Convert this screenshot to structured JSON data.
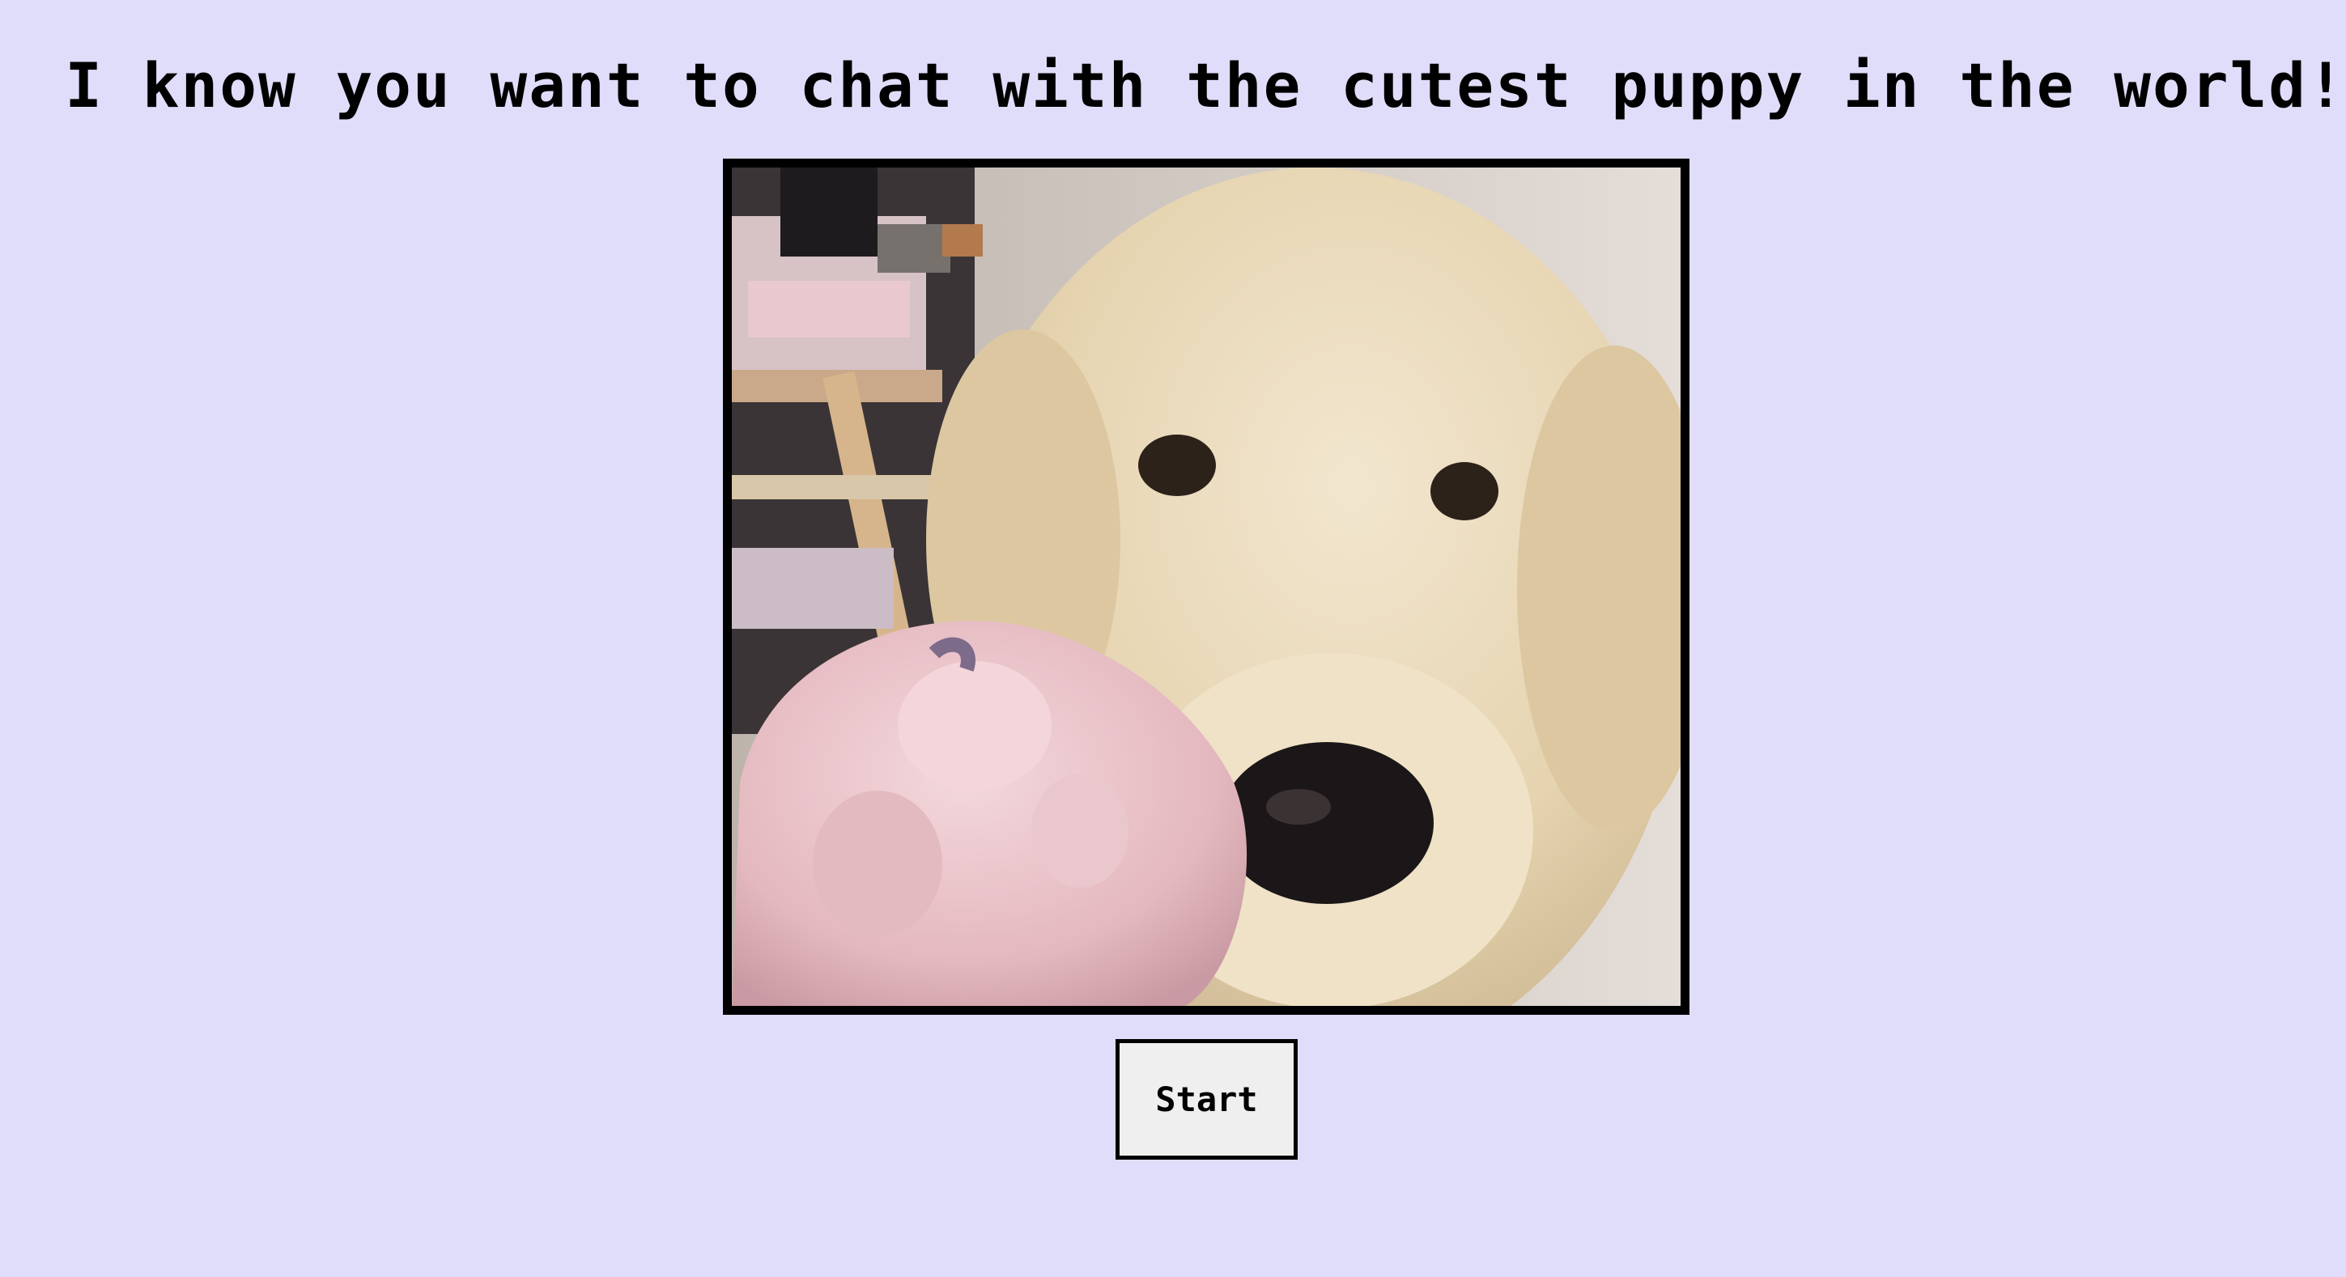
{
  "page": {
    "headline": "I know you want to chat with the cutest puppy in the world!",
    "background_color": "#dfddf9"
  },
  "photo": {
    "subject": "golden-retriever-puppy-photo"
  },
  "start_button": {
    "label": "Start"
  }
}
